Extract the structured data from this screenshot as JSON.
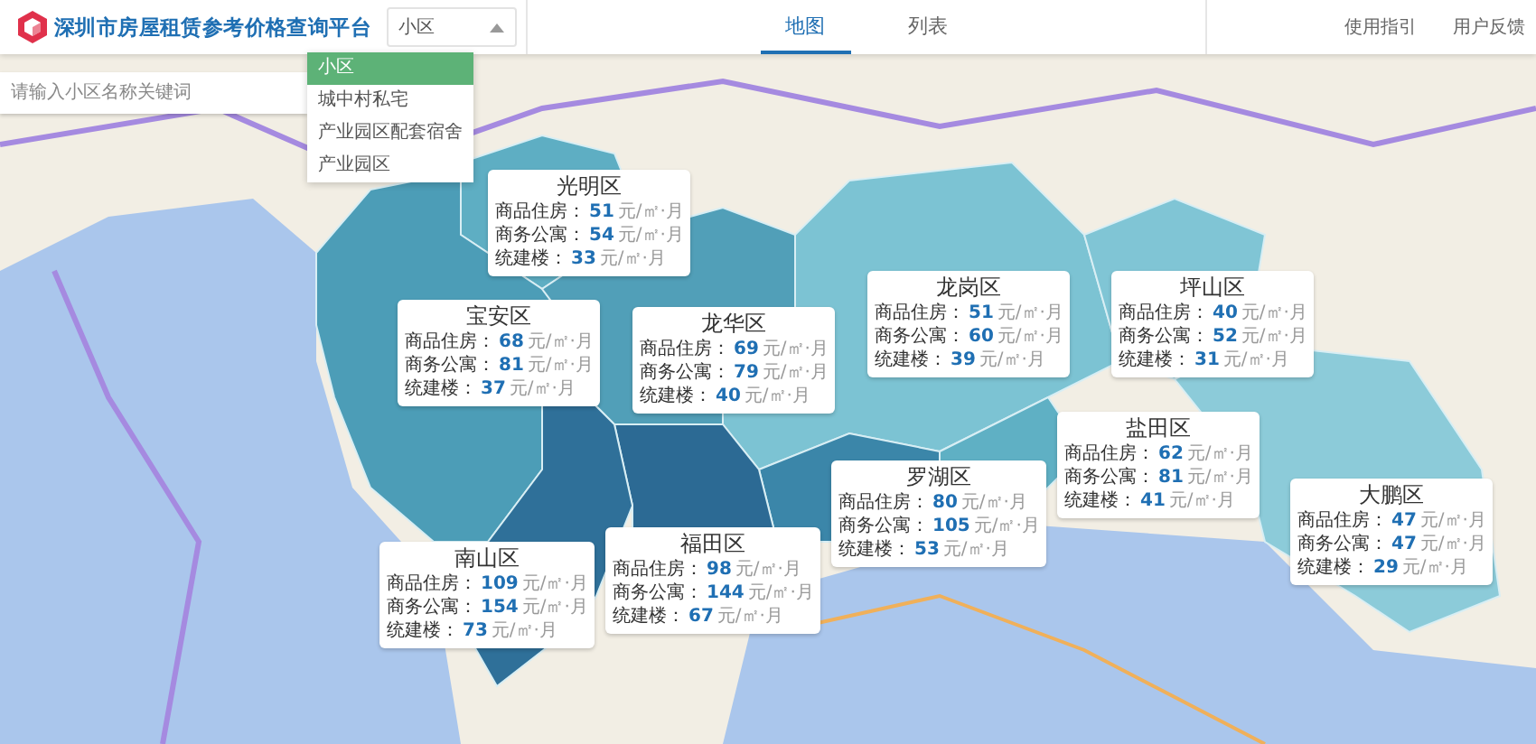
{
  "header": {
    "title": "深圳市房屋租赁参考价格查询平台",
    "category_select": {
      "value": "小区",
      "expanded": true,
      "options": [
        {
          "label": "小区",
          "selected": true
        },
        {
          "label": "城中村私宅",
          "selected": false
        },
        {
          "label": "产业园区配套宿舍",
          "selected": false
        },
        {
          "label": "产业园区",
          "selected": false
        }
      ]
    },
    "tabs": [
      {
        "label": "地图",
        "selected": true
      },
      {
        "label": "列表",
        "selected": false
      }
    ],
    "links": [
      "使用指引",
      "用户反馈"
    ]
  },
  "search": {
    "placeholder": "请输入小区名称关键词"
  },
  "map": {
    "districts": [
      {
        "name": "光明区",
        "color": "#5eaec3",
        "rows": [
          {
            "label": "商品住房：",
            "value": "51",
            "unit": "元/㎡·月"
          },
          {
            "label": "商务公寓：",
            "value": "54",
            "unit": "元/㎡·月"
          },
          {
            "label": "统建楼：",
            "value": "33",
            "unit": "元/㎡·月"
          }
        ]
      },
      {
        "name": "宝安区",
        "color": "#4c9db7",
        "rows": [
          {
            "label": "商品住房：",
            "value": "68",
            "unit": "元/㎡·月"
          },
          {
            "label": "商务公寓：",
            "value": "81",
            "unit": "元/㎡·月"
          },
          {
            "label": "统建楼：",
            "value": "37",
            "unit": "元/㎡·月"
          }
        ]
      },
      {
        "name": "龙华区",
        "color": "#519fb8",
        "rows": [
          {
            "label": "商品住房：",
            "value": "69",
            "unit": "元/㎡·月"
          },
          {
            "label": "商务公寓：",
            "value": "79",
            "unit": "元/㎡·月"
          },
          {
            "label": "统建楼：",
            "value": "40",
            "unit": "元/㎡·月"
          }
        ]
      },
      {
        "name": "龙岗区",
        "color": "#7cc3d3",
        "rows": [
          {
            "label": "商品住房：",
            "value": "51",
            "unit": "元/㎡·月"
          },
          {
            "label": "商务公寓：",
            "value": "60",
            "unit": "元/㎡·月"
          },
          {
            "label": "统建楼：",
            "value": "39",
            "unit": "元/㎡·月"
          }
        ]
      },
      {
        "name": "坪山区",
        "color": "#80c5d5",
        "rows": [
          {
            "label": "商品住房：",
            "value": "40",
            "unit": "元/㎡·月"
          },
          {
            "label": "商务公寓：",
            "value": "52",
            "unit": "元/㎡·月"
          },
          {
            "label": "统建楼：",
            "value": "31",
            "unit": "元/㎡·月"
          }
        ]
      },
      {
        "name": "盐田区",
        "color": "#5fb0c4",
        "rows": [
          {
            "label": "商品住房：",
            "value": "62",
            "unit": "元/㎡·月"
          },
          {
            "label": "商务公寓：",
            "value": "81",
            "unit": "元/㎡·月"
          },
          {
            "label": "统建楼：",
            "value": "41",
            "unit": "元/㎡·月"
          }
        ]
      },
      {
        "name": "罗湖区",
        "color": "#3b86a9",
        "rows": [
          {
            "label": "商品住房：",
            "value": "80",
            "unit": "元/㎡·月"
          },
          {
            "label": "商务公寓：",
            "value": "105",
            "unit": "元/㎡·月"
          },
          {
            "label": "统建楼：",
            "value": "53",
            "unit": "元/㎡·月"
          }
        ]
      },
      {
        "name": "福田区",
        "color": "#2c6a94",
        "rows": [
          {
            "label": "商品住房：",
            "value": "98",
            "unit": "元/㎡·月"
          },
          {
            "label": "商务公寓：",
            "value": "144",
            "unit": "元/㎡·月"
          },
          {
            "label": "统建楼：",
            "value": "67",
            "unit": "元/㎡·月"
          }
        ]
      },
      {
        "name": "南山区",
        "color": "#2f7099",
        "rows": [
          {
            "label": "商品住房：",
            "value": "109",
            "unit": "元/㎡·月"
          },
          {
            "label": "商务公寓：",
            "value": "154",
            "unit": "元/㎡·月"
          },
          {
            "label": "统建楼：",
            "value": "73",
            "unit": "元/㎡·月"
          }
        ]
      },
      {
        "name": "大鹏区",
        "color": "#8ccbd9",
        "rows": [
          {
            "label": "商品住房：",
            "value": "47",
            "unit": "元/㎡·月"
          },
          {
            "label": "商务公寓：",
            "value": "47",
            "unit": "元/㎡·月"
          },
          {
            "label": "统建楼：",
            "value": "29",
            "unit": "元/㎡·月"
          }
        ]
      }
    ]
  }
}
